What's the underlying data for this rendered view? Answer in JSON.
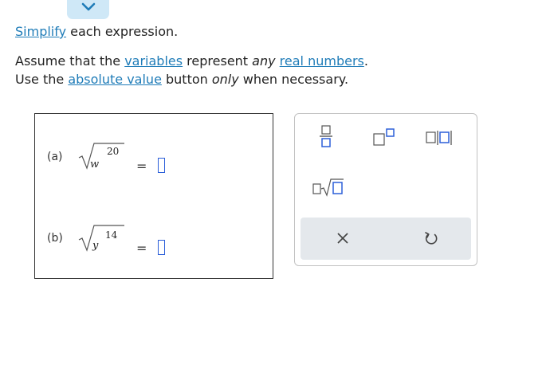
{
  "instructions": {
    "line1": {
      "link": "Simplify",
      "rest": " each expression."
    },
    "line2": {
      "pre": "Assume that the ",
      "link1": "variables",
      "mid1": " represent ",
      "emph": "any",
      "mid2": " ",
      "link2": "real numbers",
      "post": "."
    },
    "line3": {
      "pre": "Use the ",
      "link": "absolute value",
      "mid": " button ",
      "emph": "only",
      "post": " when necessary."
    }
  },
  "problems": [
    {
      "label": "(a)",
      "index": "20",
      "variable": "w",
      "equals": "="
    },
    {
      "label": "(b)",
      "index": "14",
      "variable": "y",
      "equals": "="
    }
  ],
  "toolbar": {
    "buttons": [
      "fraction-icon",
      "superscript-icon",
      "absolute-value-icon",
      "nth-root-icon",
      "clear-icon",
      "undo-icon"
    ]
  },
  "colors": {
    "link": "#1f7cb8",
    "accent_tab": "#cfe8f7",
    "answer_box": "#2b5fd9",
    "toolbar_bar": "#e4e8ec"
  }
}
